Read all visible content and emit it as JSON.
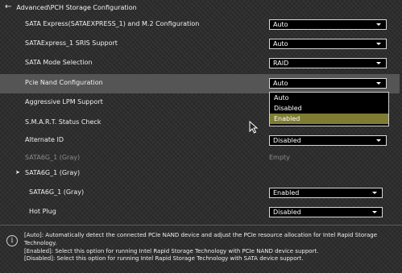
{
  "breadcrumb": "Advanced\\PCH Storage Configuration",
  "rows": [
    {
      "label": "SATA Express(SATAEXPRESS_1) and M.2 Configuration",
      "value": "Auto"
    },
    {
      "label": "SATAExpress_1 SRIS Support",
      "value": "Auto"
    },
    {
      "label": "SATA Mode Selection",
      "value": "RAID"
    },
    {
      "label": "Pcie Nand Configuration",
      "value": "Auto"
    },
    {
      "label": "Aggressive LPM Support",
      "value": ""
    },
    {
      "label": "S.M.A.R.T. Status Check",
      "value": ""
    },
    {
      "label": "Alternate ID",
      "value": "Disabled"
    },
    {
      "label": "SATA6G_1 (Gray)",
      "value": "Empty"
    },
    {
      "label": "SATA6G_1 (Gray)",
      "value": ""
    },
    {
      "label": "SATA6G_1 (Gray)",
      "value": "Enabled"
    },
    {
      "label": "Hot Plug",
      "value": "Disabled"
    }
  ],
  "dropdown": {
    "options": [
      "Auto",
      "Disabled",
      "Enabled"
    ],
    "selected": "Enabled"
  },
  "help": [
    "[Auto]: Automatically detect the connected PCIe NAND device and adjust the PCIe resource allocation for Intel Rapid Storage Technology.",
    "[Enabled]: Select this option for running Intel Rapid Storage Technology with PCIe NAND device support.",
    "[Disabled]: Select this option for running Intel Rapid Storage Technology with SATA device support."
  ],
  "icons": {
    "back": "back-arrow-icon",
    "info": "info-icon",
    "cursor": "mouse-cursor-icon"
  }
}
